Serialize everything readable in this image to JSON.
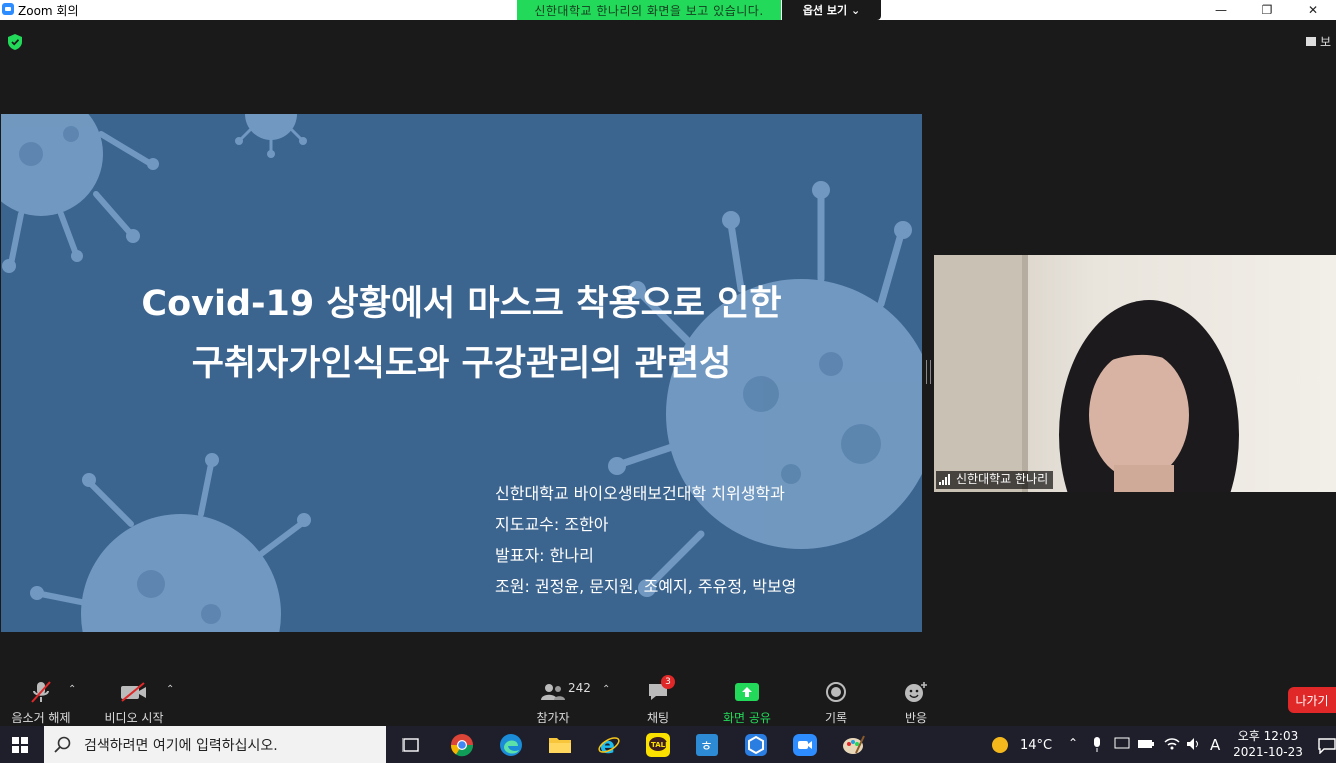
{
  "window": {
    "title": "Zoom 회의",
    "controls": {
      "minimize": "—",
      "restore": "❐",
      "close": "✕"
    }
  },
  "share_banner": {
    "text": "신한대학교 한나리의 화면을 보고 있습니다.",
    "view_options": "옵션 보기 ⌄",
    "color": "#23d959"
  },
  "top": {
    "view_label": "보"
  },
  "slide": {
    "background": "#3b648f",
    "title_lines": [
      "Covid-19 상황에서 마스크 착용으로 인한",
      "구취자가인식도와 구강관리의 관련성"
    ],
    "info_lines": [
      "신한대학교 바이오생태보건대학 치위생학과",
      "지도교수: 조한아",
      "발표자: 한나리",
      "조원: 권정윤, 문지원, 조예지, 주유정, 박보영"
    ]
  },
  "video": {
    "participant_name": "신한대학교 한나리"
  },
  "toolbar": {
    "unmute": "음소거 해제",
    "start_video": "비디오 시작",
    "participants_count": "242",
    "participants": "참가자",
    "chat": "채팅",
    "chat_badge": "3",
    "share_screen": "화면 공유",
    "record": "기록",
    "reactions": "반응",
    "leave": "나가기",
    "accent_green": "#23d959",
    "leave_color": "#e02828"
  },
  "taskbar": {
    "search_placeholder": "검색하려면 여기에 입력하십시오.",
    "weather": "14°C",
    "ime": "A",
    "time": "오후 12:03",
    "date": "2021-10-23"
  }
}
